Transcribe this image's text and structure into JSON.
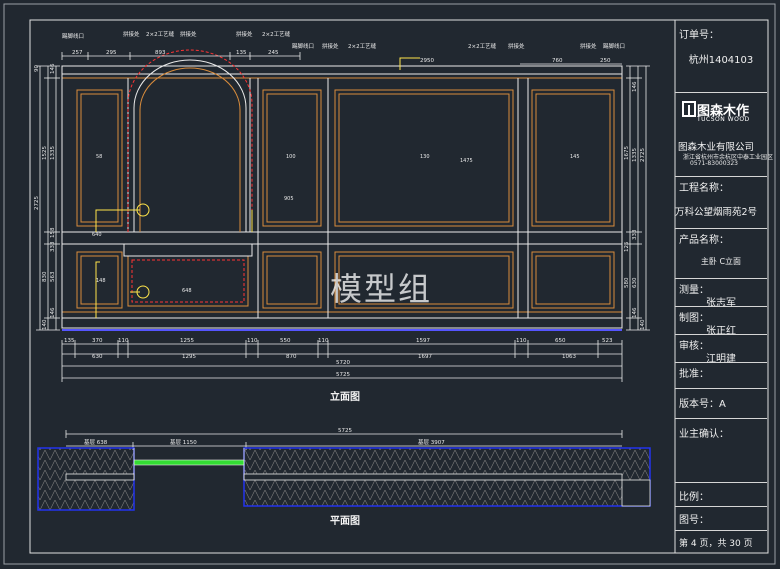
{
  "title_block": {
    "order_label": "订单号：",
    "order_value": "杭州1404103",
    "logo_brand": "图森木作",
    "logo_sub": "TUCSON WOOD",
    "company": "图森木业有限公司",
    "company_address": "浙江省杭州市余杭区中泰工业园区",
    "company_tel": "0571-83000323",
    "project_label": "工程名称：",
    "project_value": "万科公望烟雨苑2号",
    "product_label": "产品名称：",
    "product_value": "主卧 C立面",
    "measure_label": "测量：",
    "measure_value": "张志军",
    "draw_label": "制图：",
    "draw_value": "张正红",
    "review_label": "审核：",
    "review_value": "江明建",
    "approve_label": "批准：",
    "version_label": "版本号：A",
    "owner_label": "业主确认：",
    "scale_label": "比例：",
    "drawing_no_label": "图号：",
    "page_label": "第 4 页，共 30 页"
  },
  "captions": {
    "elevation": "立面图",
    "plan": "平面图"
  },
  "watermark": "模型组",
  "annotations": {
    "top_labels": [
      "踢脚线口",
      "拼接处",
      "2×2工艺缝",
      "拼接处",
      "拼接处",
      "2×2工艺缝",
      "踢脚线口",
      "拼接处",
      "2×2工艺缝",
      "2×2工艺缝",
      "拼接处",
      "拼接处",
      "踢脚线口"
    ],
    "top_dims": [
      "257",
      "295",
      "893",
      "135",
      "245",
      "2950",
      "760",
      "250"
    ],
    "left_dims": [
      "90",
      "146",
      "1525",
      "1335",
      "2725",
      "158",
      "333",
      "563",
      "830",
      "146",
      "140"
    ],
    "right_dims": [
      "146",
      "1675",
      "1335",
      "2725",
      "333",
      "125",
      "580",
      "630",
      "146",
      "140"
    ],
    "panel_values": [
      "58",
      "100",
      "130",
      "145",
      "905",
      "640",
      "648",
      "148",
      "1475"
    ],
    "bottom_row1": [
      "135",
      "370",
      "110",
      "1255",
      "110",
      "550",
      "110",
      "1597",
      "110",
      "650",
      "523"
    ],
    "bottom_row2": [
      "630",
      "1295",
      "870",
      "1697",
      "1063"
    ],
    "total_1": "5720",
    "total_2": "5725",
    "plan_total": "5725",
    "plan_segments": [
      "基层 638",
      "基层 1150",
      "基层 3907"
    ]
  },
  "colors": {
    "background": "#212830",
    "panel_line": "#d98c3c",
    "structure_line": "#eaeaea",
    "dimension_line": "#f2f2f2",
    "accent_yellow": "#ffe54a",
    "plan_blue": "#2233ee",
    "accent_green": "#33dd33",
    "accent_red": "#ff3333"
  }
}
